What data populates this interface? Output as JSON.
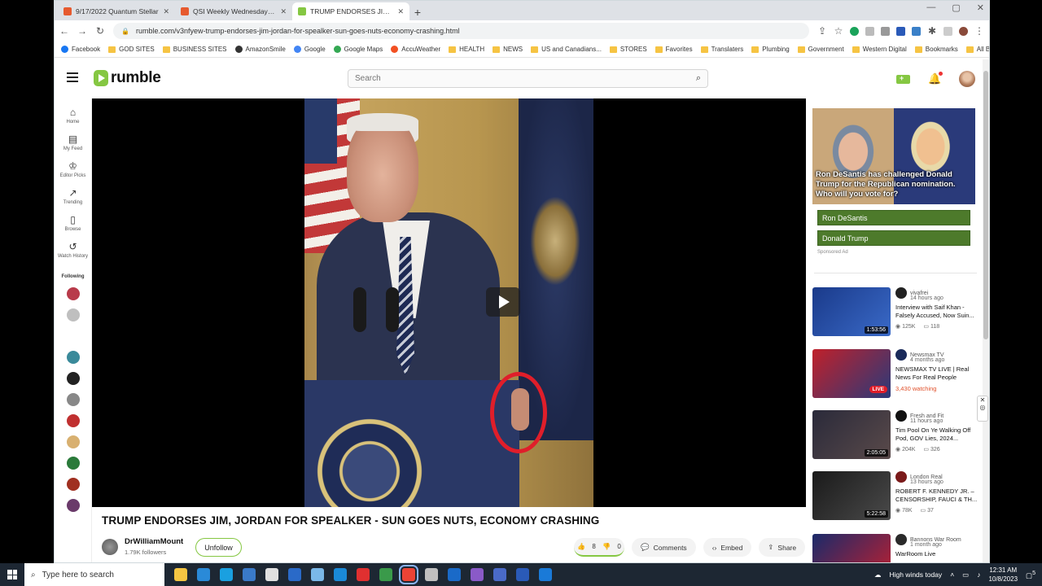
{
  "browser": {
    "tabs": [
      {
        "title": "9/17/2022 Quantum Stellar",
        "color": "#e65a2f"
      },
      {
        "title": "QSI Weekly Wednesday Panel C",
        "color": "#e65a2f"
      },
      {
        "title": "TRUMP ENDORSES JIM, JORDAN",
        "color": "#85c742"
      }
    ],
    "new_tab_label": "+",
    "url": "rumble.com/v3nfyew-trump-endorses-jim-jordan-for-spealker-sun-goes-nuts-economy-crashing.html",
    "bookmarks": [
      "Facebook",
      "GOD SITES",
      "BUSINESS SITES",
      "AmazonSmile",
      "Google",
      "Google Maps",
      "AccuWeather",
      "HEALTH",
      "NEWS",
      "US and Canadians...",
      "STORES",
      "Favorites",
      "Translaters",
      "Plumbing",
      "Government",
      "Western Digital",
      "Bookmarks"
    ],
    "all_bookmarks": "All Bookmarks"
  },
  "site": {
    "logo_text": "rumble",
    "search_placeholder": "Search",
    "nav": [
      {
        "label": "Home",
        "icon": "home-icon",
        "glyph": "⌂"
      },
      {
        "label": "My Feed",
        "icon": "feed-icon",
        "glyph": "▤"
      },
      {
        "label": "Editor Picks",
        "icon": "medal-icon",
        "glyph": "♔"
      },
      {
        "label": "Trending",
        "icon": "trending-icon",
        "glyph": "↗"
      },
      {
        "label": "Browse",
        "icon": "browse-icon",
        "glyph": "▯"
      },
      {
        "label": "Watch History",
        "icon": "history-icon",
        "glyph": "↺"
      }
    ],
    "following_label": "Following",
    "following_colors": [
      "#b83a4a",
      "#bfbfbf",
      "#ffffff",
      "#3a8a9a",
      "#222222",
      "#888888",
      "#c03030",
      "#d8b070",
      "#2a7a3a",
      "#a03020",
      "#6a3a6a"
    ]
  },
  "video": {
    "title": "TRUMP ENDORSES JIM, JORDAN FOR SPEALKER - SUN GOES NUTS, ECONOMY CRASHING",
    "channel": "DrWilliamMount",
    "followers": "1.79K followers",
    "unfollow_label": "Unfollow",
    "likes": "8",
    "dislikes": "0",
    "comments_label": "Comments",
    "embed_label": "Embed",
    "share_label": "Share"
  },
  "ad": {
    "caption": "Ron DeSantis has challenged Donald Trump for the Republican nomination. Who will you vote for?",
    "options": [
      "Ron DeSantis",
      "Donald Trump"
    ],
    "sponsored": "Sponsored Ad"
  },
  "recommendations": [
    {
      "channel": "vivafrei",
      "ago": "14 hours ago",
      "title": "Interview with Saif Khan - Falsely Accused, Now Suin...",
      "duration": "1:53:56",
      "views": "125K",
      "comments": "118",
      "live": false,
      "thumb": "linear-gradient(135deg,#1a3a8a,#3a6ac8)",
      "avatar": "#222222"
    },
    {
      "channel": "Newsmax TV",
      "ago": "4 months ago",
      "title": "NEWSMAX TV LIVE | Real News For Real People",
      "watching": "3,430 watching",
      "live": true,
      "live_label": "LIVE",
      "thumb": "linear-gradient(135deg,#c0202a,#2a3a7a)",
      "avatar": "#1a2a5a"
    },
    {
      "channel": "Fresh and Fit",
      "ago": "11 hours ago",
      "title": "Tim Pool On Ye Walking Off Pod, GOV Lies, 2024...",
      "duration": "2:05:05",
      "views": "204K",
      "comments": "326",
      "live": false,
      "thumb": "linear-gradient(135deg,#2a2a3a,#5a4a4a)",
      "avatar": "#111111"
    },
    {
      "channel": "London Real",
      "ago": "13 hours ago",
      "title": "ROBERT F. KENNEDY JR. – CENSORSHIP, FAUCI & TH...",
      "duration": "5:22:58",
      "views": "78K",
      "comments": "37",
      "live": false,
      "thumb": "linear-gradient(135deg,#1a1a1a,#4a4a4a)",
      "avatar": "#7a1a1a"
    },
    {
      "channel": "Bannons War Room",
      "ago": "1 month ago",
      "title": "WarRoom Live",
      "live": false,
      "thumb": "linear-gradient(135deg,#1a2a6a,#c02030)",
      "avatar": "#2a2a2a"
    }
  ],
  "taskbar": {
    "search_placeholder": "Type here to search",
    "apps": [
      "#f4c542",
      "#2a8ad8",
      "#1aa0e0",
      "#3a7ac8",
      "#e0e0e0",
      "#2a6ac8",
      "#7ab8e8",
      "#1a8ad8",
      "#e03030",
      "#3a9a4a",
      "#ea4335",
      "#c0c0c0",
      "#1a6ac8",
      "#8a5ac8",
      "#4a6ac8",
      "#2a5ab8",
      "#1a7ad8"
    ],
    "weather": "High winds today",
    "time": "12:31 AM",
    "date": "10/8/2023",
    "notifications": "5"
  }
}
